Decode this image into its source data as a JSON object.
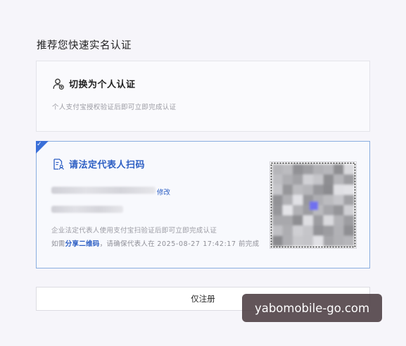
{
  "page": {
    "title": "推荐您快速实名认证"
  },
  "personal_card": {
    "icon": "user-switch-icon",
    "title": "切换为个人认证",
    "description": "个人支付宝授权验证后即可立即完成认证"
  },
  "legal_card": {
    "icon": "document-user-icon",
    "title": "请法定代表人扫码",
    "edit_label": "修改",
    "description": "企业法定代表人使用支付宝扫验证后即可立即完成认证",
    "hint_prefix": "如需",
    "hint_link": "分享二维码",
    "hint_middle": "，请确保代表人在 ",
    "hint_datetime": "2025-08-27 17:42:17",
    "hint_suffix": " 前完成",
    "selected": true
  },
  "actions": {
    "register_only": "仅注册"
  },
  "watermark": {
    "text": "yabomobile-go.com"
  },
  "colors": {
    "accent": "#2d5fc4",
    "selected_border": "#8aaee0"
  }
}
